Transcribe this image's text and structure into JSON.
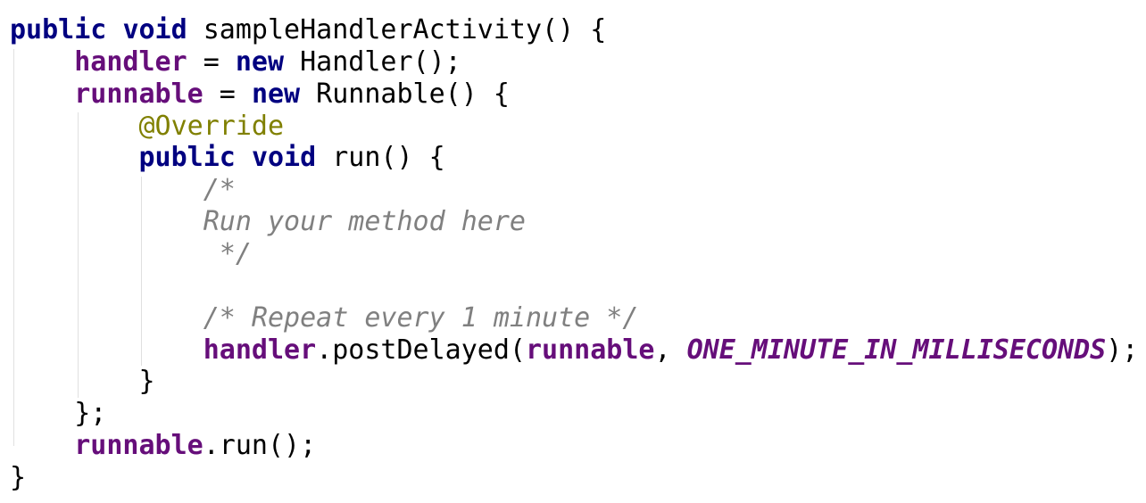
{
  "editor": {
    "language": "Java",
    "colors": {
      "background": "#ffffff",
      "keyword": "#000080",
      "field": "#660e7a",
      "annotation": "#808000",
      "comment": "#808080",
      "plain": "#000000",
      "indent_guide": "#e0e0e0"
    },
    "lines": [
      {
        "tokens": [
          {
            "text": "public",
            "kind": "keyword"
          },
          {
            "text": " ",
            "kind": "plain"
          },
          {
            "text": "void",
            "kind": "keyword"
          },
          {
            "text": " sampleHandlerActivity() {",
            "kind": "plain"
          }
        ]
      },
      {
        "tokens": [
          {
            "text": "    ",
            "kind": "plain"
          },
          {
            "text": "handler",
            "kind": "field"
          },
          {
            "text": " = ",
            "kind": "plain"
          },
          {
            "text": "new",
            "kind": "keyword"
          },
          {
            "text": " Handler();",
            "kind": "plain"
          }
        ]
      },
      {
        "tokens": [
          {
            "text": "    ",
            "kind": "plain"
          },
          {
            "text": "runnable",
            "kind": "field"
          },
          {
            "text": " = ",
            "kind": "plain"
          },
          {
            "text": "new",
            "kind": "keyword"
          },
          {
            "text": " Runnable() {",
            "kind": "plain"
          }
        ]
      },
      {
        "tokens": [
          {
            "text": "        ",
            "kind": "plain"
          },
          {
            "text": "@Override",
            "kind": "annotation"
          }
        ]
      },
      {
        "tokens": [
          {
            "text": "        ",
            "kind": "plain"
          },
          {
            "text": "public",
            "kind": "keyword"
          },
          {
            "text": " ",
            "kind": "plain"
          },
          {
            "text": "void",
            "kind": "keyword"
          },
          {
            "text": " run() {",
            "kind": "plain"
          }
        ]
      },
      {
        "tokens": [
          {
            "text": "            ",
            "kind": "plain"
          },
          {
            "text": "/*",
            "kind": "comment"
          }
        ]
      },
      {
        "tokens": [
          {
            "text": "            ",
            "kind": "plain"
          },
          {
            "text": "Run your method here",
            "kind": "comment"
          }
        ]
      },
      {
        "tokens": [
          {
            "text": "             ",
            "kind": "plain"
          },
          {
            "text": "*/",
            "kind": "comment"
          }
        ]
      },
      {
        "tokens": []
      },
      {
        "tokens": [
          {
            "text": "            ",
            "kind": "plain"
          },
          {
            "text": "/* Repeat every 1 minute */",
            "kind": "comment"
          }
        ]
      },
      {
        "tokens": [
          {
            "text": "            ",
            "kind": "plain"
          },
          {
            "text": "handler",
            "kind": "field"
          },
          {
            "text": ".postDelayed(",
            "kind": "plain"
          },
          {
            "text": "runnable",
            "kind": "field"
          },
          {
            "text": ", ",
            "kind": "plain"
          },
          {
            "text": "ONE_MINUTE_IN_MILLISECONDS",
            "kind": "constant"
          },
          {
            "text": ");",
            "kind": "plain"
          }
        ]
      },
      {
        "tokens": [
          {
            "text": "        }",
            "kind": "plain"
          }
        ]
      },
      {
        "tokens": [
          {
            "text": "    };",
            "kind": "plain"
          }
        ]
      },
      {
        "tokens": [
          {
            "text": "    ",
            "kind": "plain"
          },
          {
            "text": "runnable",
            "kind": "field"
          },
          {
            "text": ".run();",
            "kind": "plain"
          }
        ]
      },
      {
        "tokens": [
          {
            "text": "}",
            "kind": "plain"
          }
        ]
      }
    ]
  }
}
